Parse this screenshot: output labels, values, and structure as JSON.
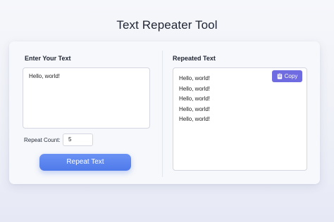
{
  "app": {
    "title": "Text Repeater Tool"
  },
  "input_section": {
    "label": "Enter Your Text",
    "text_value": "Hello, world!",
    "repeat_count_label": "Repeat Count:",
    "repeat_count_value": "5",
    "repeat_button_label": "Repeat Text"
  },
  "output_section": {
    "label": "Repeated Text",
    "copy_button_label": "Copy",
    "copy_icon": "clipboard-icon",
    "lines": [
      "Hello, world!",
      "Hello, world!",
      "Hello, world!",
      "Hello, world!",
      "Hello, world!"
    ]
  },
  "colors": {
    "primary_button": "#5a84ee",
    "copy_button": "#6f6be0",
    "card_background": "#f7f8fb"
  }
}
